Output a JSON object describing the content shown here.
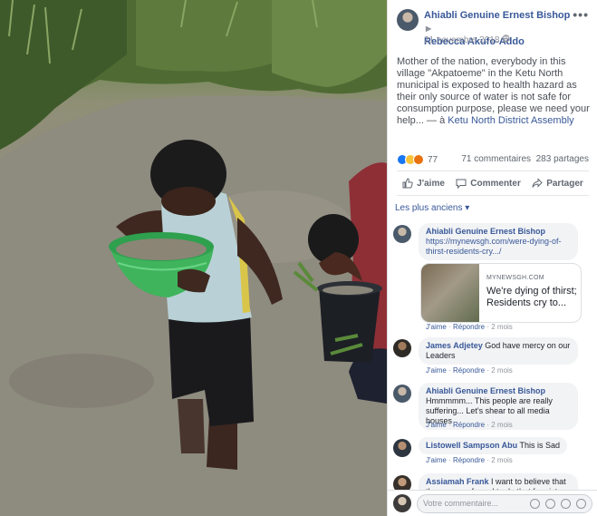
{
  "post": {
    "author": "Ahiabli Genuine Ernest Bishop",
    "recipient": "Rebecca Akufo-Addo",
    "date": "21 novembre 2018",
    "text": "Mother of the nation, everybody in this village \"Akpatoeme\" in the Ketu North municipal is exposed to health hazard as their only source of water is not safe for consumption purpose, please we need your help... — à ",
    "location_tag": "Ketu North District Assembly"
  },
  "stats": {
    "reactions_count": "77",
    "comments_count": "71 commentaires",
    "shares_count": "283 partages"
  },
  "actions": {
    "like": "J'aime",
    "comment": "Commenter",
    "share": "Partager"
  },
  "sort_label": "Les plus anciens ▾",
  "link_preview": {
    "site": "MYNEWSGH.COM",
    "title": "We're dying of thirst; Residents cry to..."
  },
  "comments": [
    {
      "author": "Ahiabli Genuine Ernest Bishop",
      "text": "https://mynewsgh.com/were-dying-of-thirst-residents-cry.../",
      "like": "J'aime",
      "reply": "Répondre",
      "time": "2 mois"
    },
    {
      "author": "James Adjetey",
      "text": "God have mercy on our Leaders",
      "like": "J'aime",
      "reply": "Répondre",
      "time": "2 mois"
    },
    {
      "author": "Ahiabli Genuine Ernest Bishop",
      "text": "Hmmmmm... This people are really suffering... Let's shear to all media houses",
      "like": "J'aime",
      "reply": "Répondre",
      "time": "2 mois"
    },
    {
      "author": "Listowell Sampson Abu",
      "text": "This is Sad",
      "like": "J'aime",
      "reply": "Répondre",
      "time": "2 mois"
    },
    {
      "author": "Assiamah Frank",
      "text": "I want to believe that the guy was forced to do that for picture"
    }
  ],
  "composer": {
    "placeholder": "Votre commentaire..."
  },
  "icons": {
    "more": "more-options-icon",
    "globe": "globe-icon",
    "like": "thumbs-up-icon",
    "comment": "comment-bubble-icon",
    "share": "share-arrow-icon",
    "emoji": "emoji-icon",
    "camera": "camera-icon",
    "gif": "gif-icon",
    "sticker": "sticker-icon"
  },
  "colors": {
    "link": "#385898",
    "meta": "#90949c",
    "bubble": "#f2f3f5",
    "like_blue": "#1877f2"
  }
}
